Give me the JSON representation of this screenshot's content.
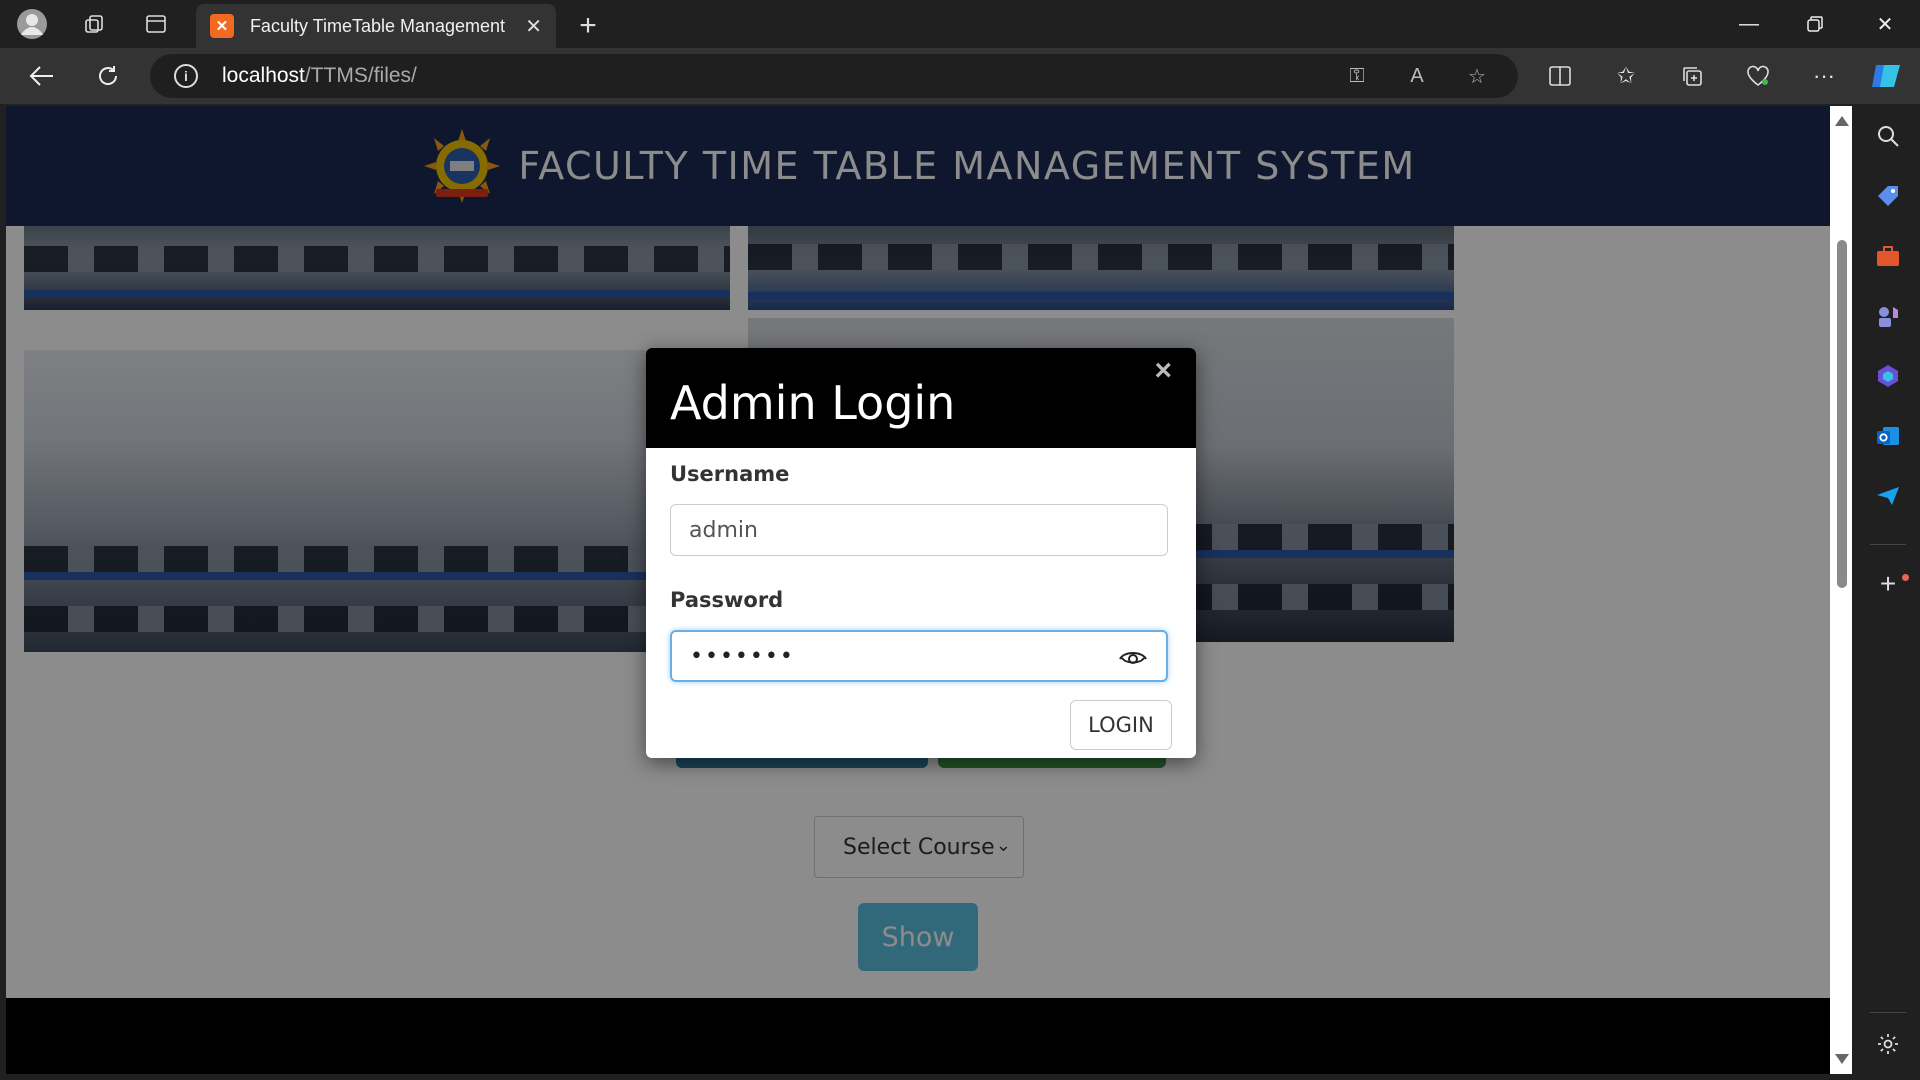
{
  "browser": {
    "tab_title": "Faculty TimeTable Management S",
    "tab_favicon": "xampp-icon",
    "address_host": "localhost",
    "address_path": "/TTMS/files/"
  },
  "page": {
    "site_title": "FACULTY TIME TABLE MANAGEMENT SYSTEM",
    "select_course": "Select Course",
    "show_button": "Show"
  },
  "modal": {
    "title": "Admin Login",
    "close": "×",
    "username_label": "Username",
    "username_value": "admin",
    "password_label": "Password",
    "password_value": "•••••••",
    "login_button": "LOGIN"
  },
  "colors": {
    "header_bg": "#1b2a52",
    "show_button": "#5bc0de",
    "modal_header": "#000000",
    "focus_border": "#66afe9"
  }
}
